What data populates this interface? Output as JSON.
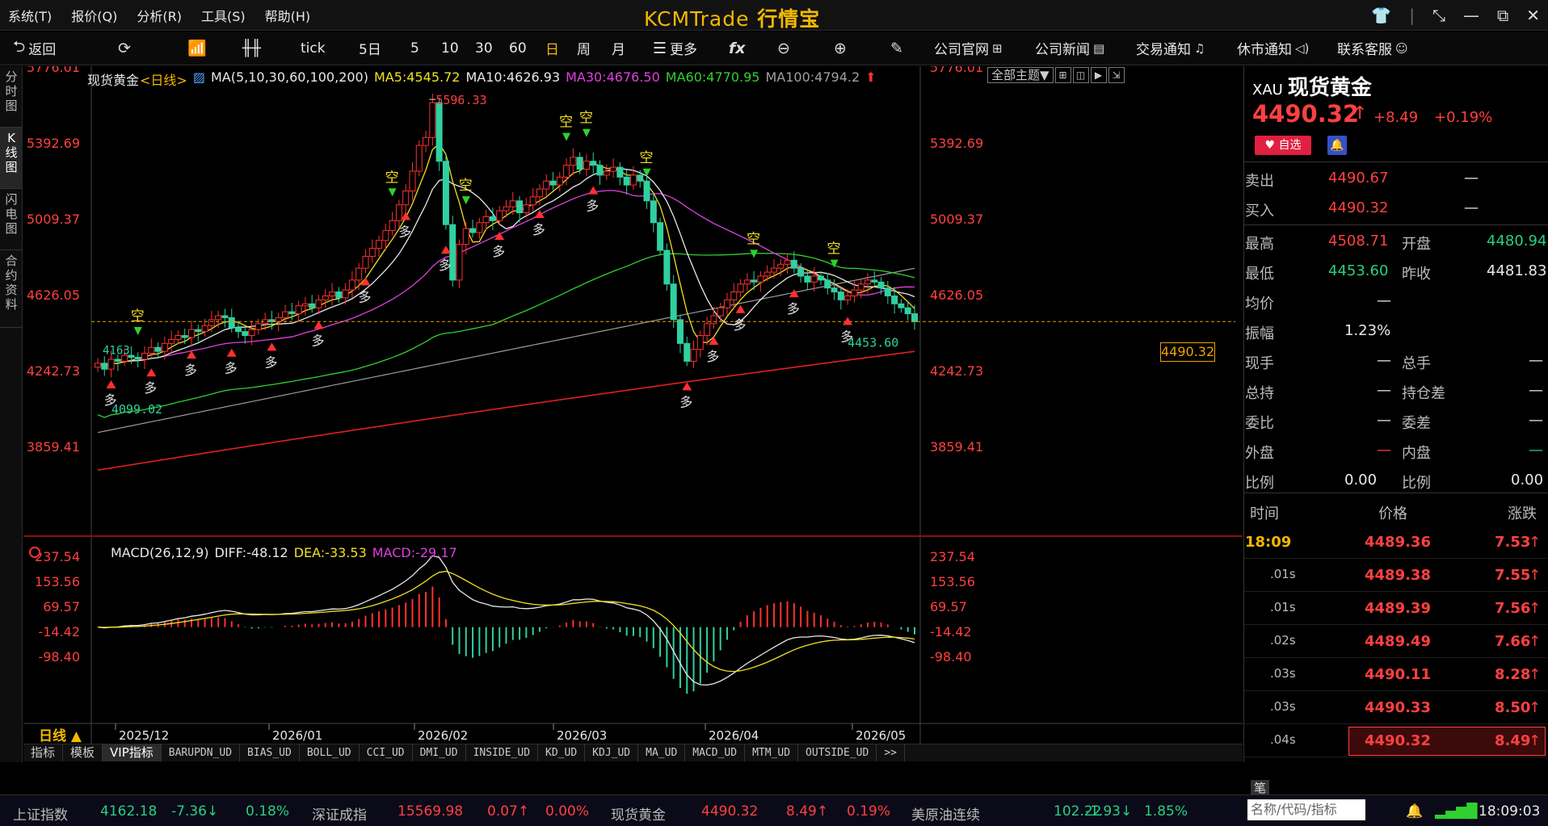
{
  "menu": [
    "系统(T)",
    "报价(Q)",
    "分析(R)",
    "工具(S)",
    "帮助(H)"
  ],
  "brand": {
    "logo": "KCMTrade",
    "name": "行情宝"
  },
  "window_controls": [
    "shirt-icon",
    "pin-icon",
    "minimize-icon",
    "restore-icon",
    "close-icon"
  ],
  "toolbar": {
    "back": "返回",
    "tick": "tick",
    "periods": [
      "5日",
      "5",
      "10",
      "30",
      "60",
      "日",
      "周",
      "月"
    ],
    "active_period": "日",
    "more": "更多",
    "links": [
      "公司官网",
      "公司新闻",
      "交易通知",
      "休市通知",
      "联系客服"
    ]
  },
  "vtabs": [
    "分时图",
    "K线图",
    "闪电图",
    "合约资料"
  ],
  "chart": {
    "title": "现货黄金",
    "period_tag": "<日线>",
    "ma_header": "MA(5,10,30,60,100,200)",
    "ma": [
      {
        "label": "MA5:4545.72",
        "color": "#f0e020"
      },
      {
        "label": "MA10:4626.93",
        "color": "#e8e8e8"
      },
      {
        "label": "MA30:4676.50",
        "color": "#e040e0"
      },
      {
        "label": "MA60:4770.95",
        "color": "#30d030"
      },
      {
        "label": "MA100:4794.2",
        "color": "#a0a0a0"
      }
    ],
    "theme": "全部主题▼",
    "y_labels": [
      "5776.01",
      "5392.69",
      "5009.37",
      "4626.05",
      "4242.73",
      "3859.41"
    ],
    "x_labels": [
      "2025/12",
      "2026/01",
      "2026/02",
      "2026/03",
      "2026/04",
      "2026/05"
    ],
    "annotations": {
      "high": "5596.33",
      "low": "4099.02",
      "recent_low": "4453.60",
      "start_low": "4163"
    },
    "current_price": "4490.32",
    "period_label": "日线 ▲",
    "markers": {
      "buy": "多",
      "sell": "空"
    }
  },
  "macd": {
    "header": "MACD(26,12,9)",
    "diff": "DIFF:-48.12",
    "dea": "DEA:-33.53",
    "macd": "MACD:-29.17",
    "y_labels": [
      "237.54",
      "153.56",
      "69.57",
      "-14.42",
      "-98.40"
    ]
  },
  "chart_data": {
    "type": "candlestick",
    "title": "现货黄金",
    "period": "日线",
    "x_range": [
      "2025/12",
      "2026/05"
    ],
    "ylim": [
      3700,
      5900
    ],
    "closes": [
      4280,
      4250,
      4300,
      4290,
      4320,
      4310,
      4300,
      4330,
      4360,
      4340,
      4380,
      4400,
      4420,
      4410,
      4450,
      4440,
      4470,
      4500,
      4520,
      4510,
      4460,
      4440,
      4420,
      4450,
      4480,
      4500,
      4490,
      4510,
      4540,
      4530,
      4570,
      4580,
      4560,
      4600,
      4620,
      4640,
      4610,
      4650,
      4700,
      4760,
      4820,
      4860,
      4900,
      4950,
      5000,
      5080,
      5150,
      5250,
      5380,
      5420,
      5596,
      5300,
      4980,
      4700,
      4880,
      4960,
      4940,
      4990,
      5020,
      5000,
      5050,
      5070,
      5100,
      5040,
      5080,
      5120,
      5160,
      5200,
      5180,
      5220,
      5280,
      5320,
      5260,
      5300,
      5280,
      5230,
      5250,
      5270,
      5220,
      5180,
      5230,
      5200,
      5100,
      4990,
      4850,
      4680,
      4500,
      4380,
      4290,
      4350,
      4420,
      4480,
      4520,
      4560,
      4600,
      4640,
      4680,
      4700,
      4690,
      4720,
      4740,
      4760,
      4780,
      4800,
      4760,
      4720,
      4690,
      4720,
      4700,
      4660,
      4640,
      4600,
      4620,
      4650,
      4680,
      4700,
      4690,
      4660,
      4620,
      4580,
      4560,
      4530,
      4490
    ],
    "ma200": {
      "start": 3740,
      "end": 4340
    },
    "macd": {
      "diff_last": -48.12,
      "dea_last": -33.53,
      "hist_last": -29.17,
      "ylim": [
        -140,
        260
      ]
    }
  },
  "quote": {
    "code": "XAU",
    "name": "现货黄金",
    "price": "4490.32",
    "change": "+8.49",
    "pct": "+0.19%",
    "fav": "自选",
    "sell": {
      "label": "卖出",
      "value": "4490.67",
      "vol": "—"
    },
    "buy": {
      "label": "买入",
      "value": "4490.32",
      "vol": "—"
    },
    "rows": [
      {
        "l1": "最高",
        "v1": "4508.71",
        "c1": "red",
        "l2": "开盘",
        "v2": "4480.94",
        "c2": "green"
      },
      {
        "l1": "最低",
        "v1": "4453.60",
        "c1": "green",
        "l2": "昨收",
        "v2": "4481.83",
        "c2": "white"
      },
      {
        "l1": "均价",
        "v1": "—",
        "c1": "white",
        "l2": "",
        "v2": "",
        "c2": "white"
      },
      {
        "l1": "振幅",
        "v1": "1.23%",
        "c1": "white",
        "l2": "",
        "v2": "",
        "c2": "white"
      },
      {
        "l1": "现手",
        "v1": "—",
        "c1": "white",
        "l2": "总手",
        "v2": "—",
        "c2": "white"
      },
      {
        "l1": "总持",
        "v1": "—",
        "c1": "white",
        "l2": "持仓差",
        "v2": "—",
        "c2": "white"
      },
      {
        "l1": "委比",
        "v1": "—",
        "c1": "white",
        "l2": "委差",
        "v2": "—",
        "c2": "white"
      },
      {
        "l1": "外盘",
        "v1": "—",
        "c1": "red",
        "l2": "内盘",
        "v2": "—",
        "c2": "green"
      },
      {
        "l1": "比例",
        "v1": "0.00",
        "c1": "white",
        "l2": "比例",
        "v2": "0.00",
        "c2": "white"
      }
    ],
    "tick_head": [
      "时间",
      "价格",
      "涨跌"
    ],
    "ticks": [
      {
        "t": "18:09",
        "p": "4489.36",
        "c": "7.53"
      },
      {
        "t": ".01s",
        "p": "4489.38",
        "c": "7.55"
      },
      {
        "t": ".01s",
        "p": "4489.39",
        "c": "7.56"
      },
      {
        "t": ".02s",
        "p": "4489.49",
        "c": "7.66"
      },
      {
        "t": ".03s",
        "p": "4490.11",
        "c": "8.28"
      },
      {
        "t": ".03s",
        "p": "4490.33",
        "c": "8.50"
      },
      {
        "t": ".04s",
        "p": "4490.32",
        "c": "8.49"
      }
    ],
    "bi": "笔"
  },
  "ind_tabs": [
    "指标",
    "模板",
    "VIP指标",
    "BARUPDN_UD",
    "BIAS_UD",
    "BOLL_UD",
    "CCI_UD",
    "DMI_UD",
    "INSIDE_UD",
    "KD_UD",
    "KDJ_UD",
    "MA_UD",
    "MACD_UD",
    "MTM_UD",
    "OUTSIDE_UD",
    ">>"
  ],
  "status": {
    "items": [
      {
        "name": "上证指数",
        "value": "4162.18",
        "change": "-7.36↓",
        "pct": "0.18%"
      },
      {
        "name": "深证成指",
        "value": "15569.98",
        "change": "0.07↑",
        "pct": "0.00%"
      },
      {
        "name": "现货黄金",
        "value": "4490.32",
        "change": "8.49↑",
        "pct": "0.19%"
      },
      {
        "name": "美原油连续",
        "value": "102.22",
        "change": "-1.93↓",
        "pct": "1.85%"
      }
    ],
    "search_placeholder": "名称/代码/指标",
    "time": "18:09:03"
  }
}
